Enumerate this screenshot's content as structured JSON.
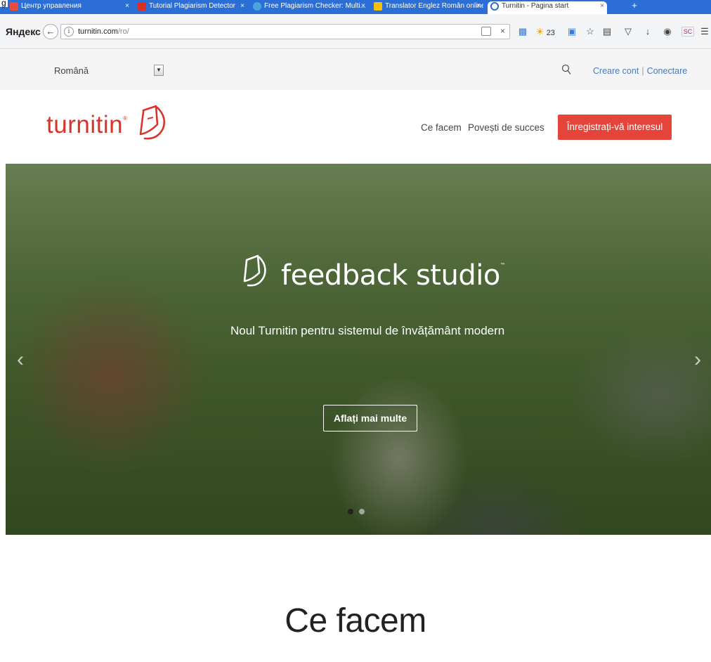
{
  "corner": {
    "text": "g"
  },
  "browser": {
    "brand": "Яндекс",
    "tabs": [
      {
        "title": "Центр управления",
        "favicon_color": "#e84c3d"
      },
      {
        "title": "Tutorial Plagiarism Detector",
        "favicon_color": "#d93025"
      },
      {
        "title": "Free Plagiarism Checker: Multi...",
        "favicon_color": "#4aa3df"
      },
      {
        "title": "Translator Englez Român online",
        "favicon_color": "#f4c20d"
      },
      {
        "title": "Turnitin - Pagina start",
        "favicon_color": "#2b6fd6"
      }
    ],
    "tab_close": "×",
    "new_tab": "+",
    "url_host": "turnitin.com",
    "url_path": "/ro/",
    "weather": "23",
    "sc_label": "SC"
  },
  "site": {
    "language": "Română",
    "links": {
      "create_account": "Creare cont",
      "separator": "|",
      "login": "Conectare"
    },
    "logo": {
      "text_pre": "turn",
      "text_i": "i",
      "text_post": "tin",
      "tm": "®"
    },
    "nav": {
      "what_we_do": "Ce facem",
      "success_stories": "Povești de succes"
    },
    "cta": "Înregistrați-vă interesul"
  },
  "hero": {
    "title": "feedback studio",
    "tm": "™",
    "subtitle": "Noul Turnitin pentru sistemul de învățământ modern",
    "button": "Aflați mai multe",
    "prev": "‹",
    "next": "›",
    "active_slide": 1,
    "slide_count": 2
  },
  "section": {
    "title": "Ce facem"
  },
  "colors": {
    "brand_red": "#d9342b",
    "cta_red": "#e4443a",
    "link_blue": "#4a7bb8",
    "tab_blue": "#2b6fd6"
  }
}
